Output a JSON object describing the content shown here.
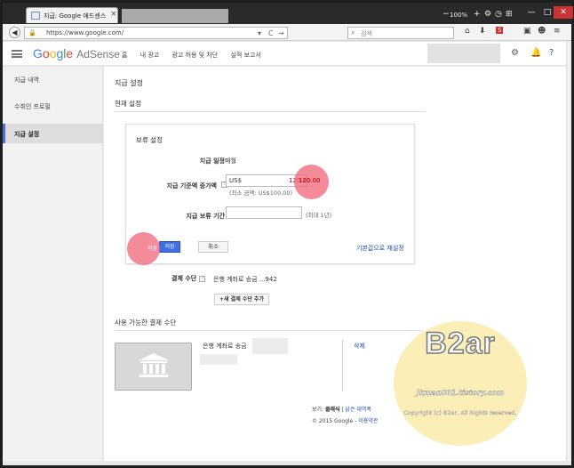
{
  "browser": {
    "tab_title": "지급: Google 애드센스",
    "tab_close": "×",
    "tab_new": "+",
    "zoom": "100%",
    "url": "https://www.google.com/",
    "search_placeholder": "검색",
    "window_min": "—",
    "window_max": "□",
    "window_close": "✕"
  },
  "header": {
    "logo": {
      "g1": "G",
      "g2": "o",
      "g3": "o",
      "g4": "g",
      "g5": "l",
      "g6": "e",
      "product": "AdSense"
    },
    "nav": [
      "홈",
      "내 광고",
      "광고 허용 및 차단",
      "실적 보고서"
    ]
  },
  "sidebar": {
    "items": [
      {
        "label": "지급 내역"
      },
      {
        "label": "수취인 프로필"
      },
      {
        "label": "지급 설정"
      }
    ]
  },
  "main": {
    "title": "지급 설정",
    "subtitle": "현재 설정",
    "hold": {
      "title": "보류 설정",
      "schedule_label": "지급 일정",
      "schedule_value": "매월",
      "threshold_label": "지급 기준액 증가액",
      "currency": "US$",
      "threshold_value": "120.00",
      "threshold_hint": "(최소 금액: US$100.00)",
      "hold_label": "지급 보류 기간",
      "hold_value": "",
      "hold_hint": "(최대 1년)",
      "save": "저장",
      "cancel": "취소",
      "reset": "기본값으로 재설정"
    },
    "payment_method_label": "결제 수단",
    "payment_method_value": "은행 계좌로 송금 ...942",
    "add_payment": "+새 결제 수단 추가",
    "available_title": "사용 가능한 결제 수단",
    "bank_transfer": "은행 계좌로 송금",
    "delete": "삭제",
    "footer_view": "보기:",
    "footer_current": "클래식",
    "footer_sep": "|",
    "footer_other": "낡은 대역폭",
    "footer_copyright": "© 2015 Google -",
    "footer_terms": "이용약관"
  },
  "watermark": {
    "big": "B2ar",
    "url": "Jkman001.tistory.com",
    "copy": "Copyright (c) B2ar, All Rights reserved."
  },
  "colors": {
    "accent": "#3f6fe0",
    "highlight": "#f06478",
    "sidebar_active_border": "#4d72d6"
  }
}
